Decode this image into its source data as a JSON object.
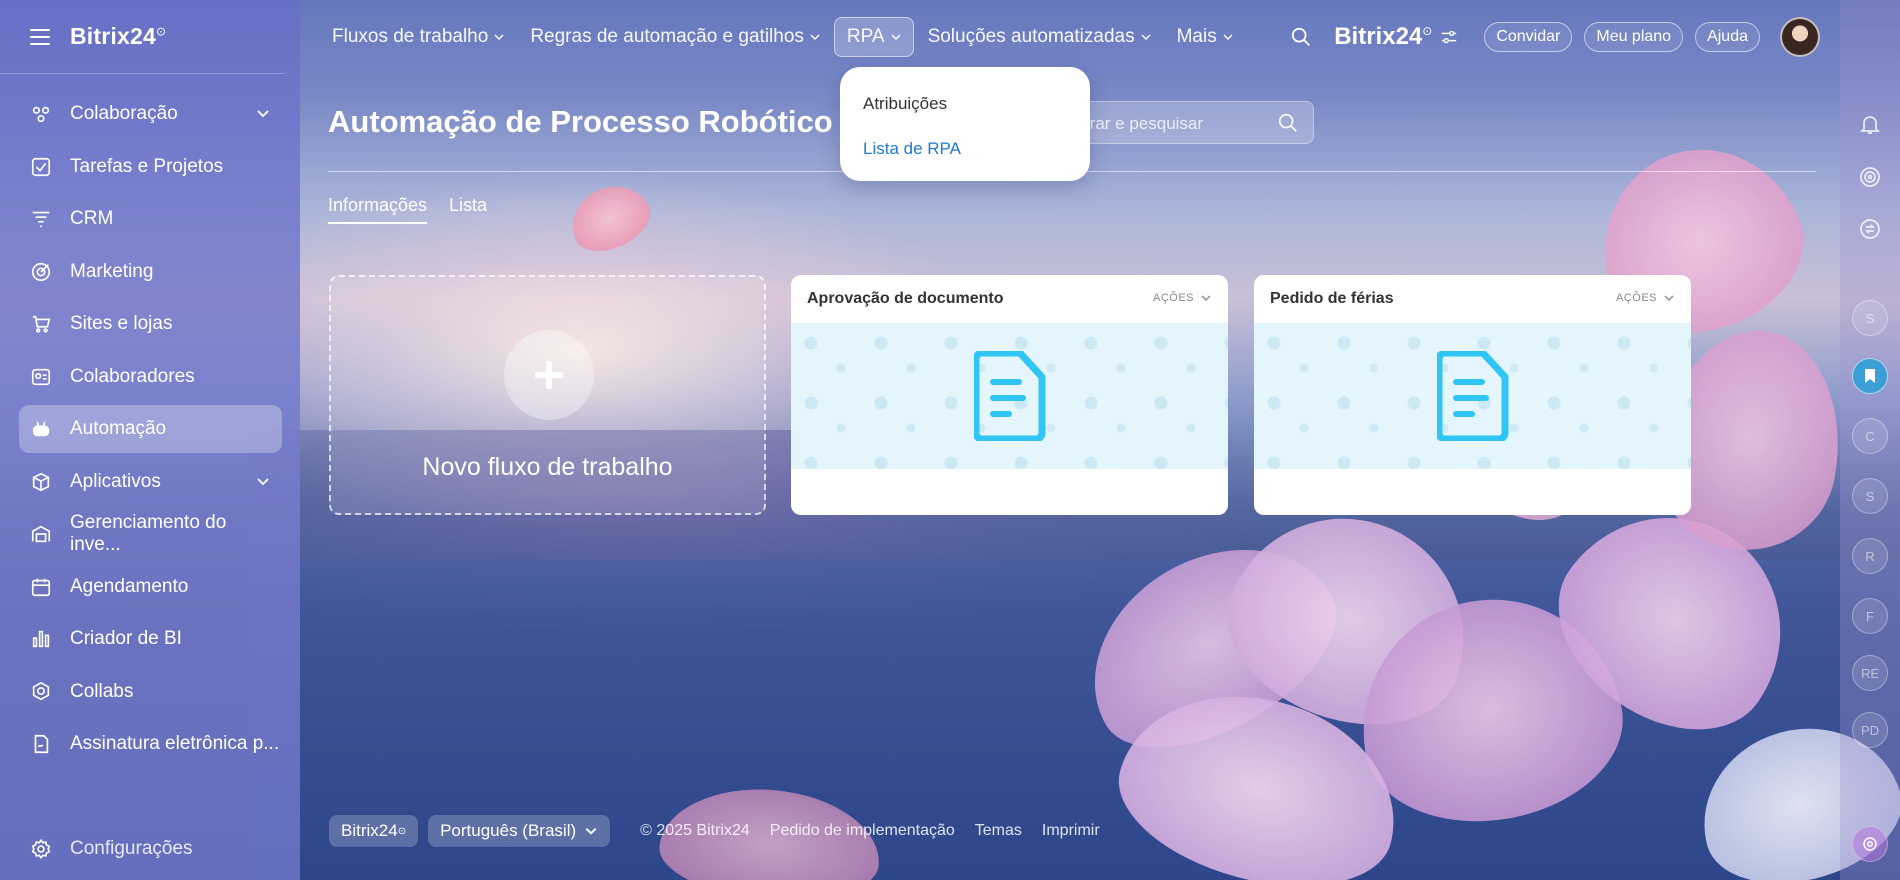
{
  "sidebar": {
    "logo": "Bitrix24",
    "items": [
      {
        "label": "Colaboração",
        "icon": "collaboration-icon",
        "chevron": true
      },
      {
        "label": "Tarefas e Projetos",
        "icon": "tasks-icon"
      },
      {
        "label": "CRM",
        "icon": "crm-icon"
      },
      {
        "label": "Marketing",
        "icon": "marketing-icon"
      },
      {
        "label": "Sites e lojas",
        "icon": "cart-icon"
      },
      {
        "label": "Colaboradores",
        "icon": "employees-icon"
      },
      {
        "label": "Automação",
        "icon": "robot-icon",
        "active": true
      },
      {
        "label": "Aplicativos",
        "icon": "box-icon",
        "chevron": true
      },
      {
        "label": "Gerenciamento do inve...",
        "icon": "warehouse-icon"
      },
      {
        "label": "Agendamento",
        "icon": "calendar-icon"
      },
      {
        "label": "Criador de BI",
        "icon": "bar-chart-icon"
      },
      {
        "label": "Collabs",
        "icon": "collabs-icon"
      },
      {
        "label": "Assinatura eletrônica p...",
        "icon": "signature-icon"
      }
    ],
    "settings": "Configurações"
  },
  "topnav": {
    "items": [
      {
        "label": "Fluxos de trabalho"
      },
      {
        "label": "Regras de automação e gatilhos"
      },
      {
        "label": "RPA",
        "active": true
      },
      {
        "label": "Soluções automatizadas"
      },
      {
        "label": "Mais"
      }
    ],
    "brand": "Bitrix24",
    "invite": "Convidar",
    "plan": "Meu plano",
    "help": "Ajuda"
  },
  "dropdown": {
    "items": [
      "Atribuições",
      "Lista de RPA"
    ]
  },
  "page": {
    "title": "Automação de Processo Robótico (RPA)",
    "filter_placeholder": "Filtrar e pesquisar",
    "tabs": [
      "Informações",
      "Lista"
    ],
    "new_card_label": "Novo fluxo de trabalho",
    "cards": [
      {
        "title": "Aprovação de documento",
        "actions": "AÇÕES"
      },
      {
        "title": "Pedido de férias",
        "actions": "AÇÕES"
      }
    ]
  },
  "rightpanel": {
    "avatars": [
      "S",
      "",
      "C",
      "S",
      "R",
      "F",
      "RE",
      "PD"
    ]
  },
  "footer": {
    "brand": "Bitrix24",
    "language": "Português (Brasil)",
    "copyright": "© 2025 Bitrix24",
    "links": [
      "Pedido de implementação",
      "Temas",
      "Imprimir"
    ]
  },
  "colors": {
    "accent": "#2fc6f6",
    "link": "#1f7ad6",
    "active_nav_bg": "rgba(255,255,255,0.28)"
  }
}
